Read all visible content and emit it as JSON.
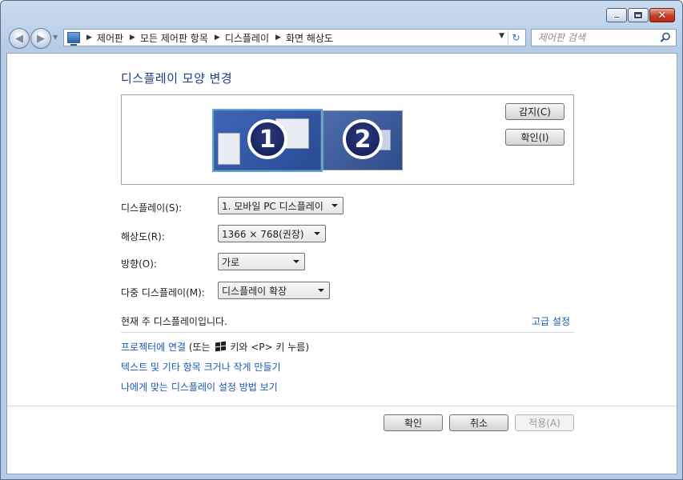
{
  "window": {
    "minimize_icon": "minimize-icon",
    "maximize_icon": "maximize-icon",
    "close_icon": "close-icon"
  },
  "nav": {
    "breadcrumbs": [
      "제어판",
      "모든 제어판 항목",
      "디스플레이",
      "화면 해상도"
    ],
    "search_placeholder": "제어판 검색"
  },
  "page": {
    "title": "디스플레이 모양 변경",
    "monitors": [
      {
        "number": "1",
        "selected": true
      },
      {
        "number": "2",
        "selected": false
      }
    ],
    "detect_label": "감지(C)",
    "identify_label": "확인(I)"
  },
  "settings": {
    "display": {
      "label": "디스플레이(S):",
      "value": "1. 모바일 PC 디스플레이"
    },
    "resolution": {
      "label": "해상도(R):",
      "value": "1366 × 768(권장)"
    },
    "orientation": {
      "label": "방향(O):",
      "value": "가로"
    },
    "multiple": {
      "label": "다중 디스플레이(M):",
      "value": "디스플레이 확장"
    }
  },
  "status": "현재 주 디스플레이입니다.",
  "advanced_link": "고급 설정",
  "links": {
    "projector_prefix": "프로젝터에 연결",
    "projector_suffix_a": " (또는 ",
    "projector_suffix_b": " 키와 <P> 키 누름)",
    "text_size": "텍스트 및 기타 항목 크거나 작게 만들기",
    "help": "나에게 맞는 디스플레이 설정 방법 보기"
  },
  "footer": {
    "ok": "확인",
    "cancel": "취소",
    "apply": "적용(A)"
  },
  "colors": {
    "title": "#1e3a8a",
    "link": "#1a57b7",
    "selection": "#5aa5e6"
  }
}
